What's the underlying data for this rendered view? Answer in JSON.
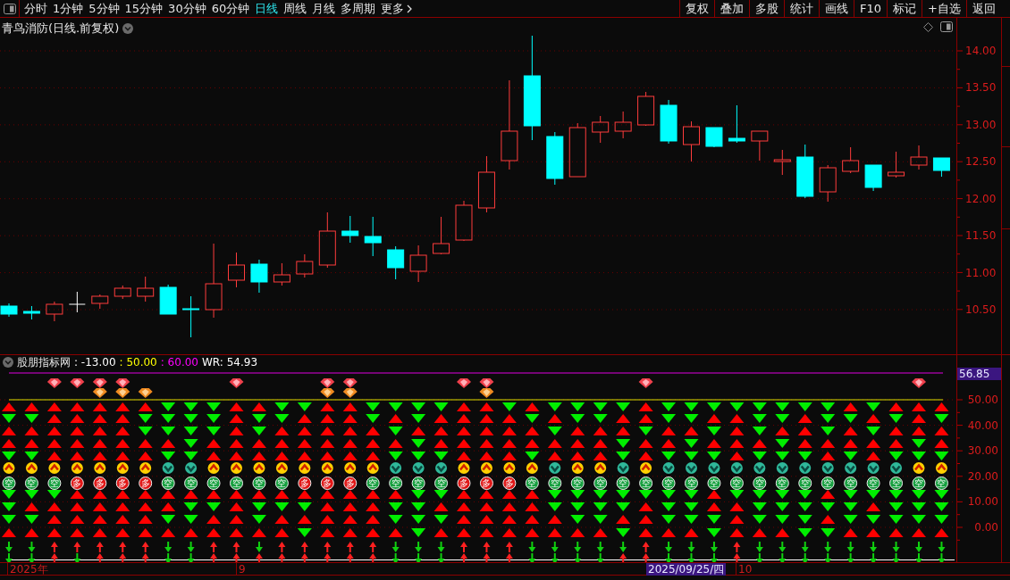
{
  "toolbar": {
    "periods": [
      {
        "label": "分时",
        "selected": false
      },
      {
        "label": "1分钟",
        "selected": false
      },
      {
        "label": "5分钟",
        "selected": false
      },
      {
        "label": "15分钟",
        "selected": false
      },
      {
        "label": "30分钟",
        "selected": false
      },
      {
        "label": "60分钟",
        "selected": false
      },
      {
        "label": "日线",
        "selected": true
      },
      {
        "label": "周线",
        "selected": false
      },
      {
        "label": "月线",
        "selected": false
      },
      {
        "label": "多周期",
        "selected": false
      },
      {
        "label": "更多",
        "selected": false
      }
    ],
    "actions": [
      "复权",
      "叠加",
      "多股",
      "统计",
      "画线",
      "F10",
      "标记",
      "+自选",
      "返回"
    ]
  },
  "price_pane": {
    "title": "青鸟消防(日线.前复权)",
    "axis_labels": [
      "14.00",
      "13.50",
      "13.00",
      "12.50",
      "12.00",
      "11.50",
      "11.00",
      "10.50"
    ]
  },
  "indicator": {
    "name": "股朋指标网",
    "values": [
      {
        "text": ": -13.00",
        "color": "#ffffff"
      },
      {
        "text": ": 50.00",
        "color": "#ffff00"
      },
      {
        "text": ": 60.00",
        "color": "#ff00ff"
      },
      {
        "text": "WR: 54.93",
        "color": "#ffffff"
      }
    ],
    "current_value": "56.85",
    "axis_labels": [
      "50.00",
      "40.00",
      "30.00",
      "20.00",
      "10.00",
      "0.00"
    ],
    "badges": [
      {
        "text": "空",
        "color": "#18a040"
      },
      {
        "text": "空",
        "color": "#18a040"
      },
      {
        "text": "空",
        "color": "#18a040"
      },
      {
        "text": "多",
        "color": "#e01818"
      },
      {
        "text": "多",
        "color": "#e01818"
      },
      {
        "text": "多",
        "color": "#e01818"
      },
      {
        "text": "多",
        "color": "#e01818"
      },
      {
        "text": "空",
        "color": "#18a040"
      },
      {
        "text": "空",
        "color": "#18a040"
      },
      {
        "text": "空",
        "color": "#18a040"
      },
      {
        "text": "空",
        "color": "#18a040"
      },
      {
        "text": "空",
        "color": "#18a040"
      },
      {
        "text": "空",
        "color": "#18a040"
      },
      {
        "text": "多",
        "color": "#e01818"
      },
      {
        "text": "多",
        "color": "#e01818"
      },
      {
        "text": "多",
        "color": "#e01818"
      },
      {
        "text": "空",
        "color": "#18a040"
      },
      {
        "text": "空",
        "color": "#18a040"
      },
      {
        "text": "空",
        "color": "#18a040"
      },
      {
        "text": "空",
        "color": "#18a040"
      },
      {
        "text": "多",
        "color": "#e01818"
      },
      {
        "text": "多",
        "color": "#e01818"
      },
      {
        "text": "多",
        "color": "#e01818"
      },
      {
        "text": "空",
        "color": "#18a040"
      },
      {
        "text": "空",
        "color": "#18a040"
      },
      {
        "text": "空",
        "color": "#18a040"
      },
      {
        "text": "空",
        "color": "#18a040"
      },
      {
        "text": "空",
        "color": "#18a040"
      },
      {
        "text": "空",
        "color": "#18a040"
      },
      {
        "text": "空",
        "color": "#18a040"
      },
      {
        "text": "空",
        "color": "#18a040"
      },
      {
        "text": "空",
        "color": "#18a040"
      },
      {
        "text": "空",
        "color": "#18a040"
      },
      {
        "text": "空",
        "color": "#18a040"
      },
      {
        "text": "空",
        "color": "#18a040"
      },
      {
        "text": "空",
        "color": "#18a040"
      },
      {
        "text": "空",
        "color": "#18a040"
      },
      {
        "text": "空",
        "color": "#18a040"
      },
      {
        "text": "空",
        "color": "#18a040"
      },
      {
        "text": "空",
        "color": "#18a040"
      },
      {
        "text": "空",
        "color": "#18a040"
      },
      {
        "text": "空",
        "color": "#18a040"
      }
    ]
  },
  "date_axis": [
    {
      "text": "2025年",
      "selected": false
    },
    {
      "text": "9",
      "selected": false
    },
    {
      "text": "2025/09/25/四",
      "selected": true
    },
    {
      "text": "10",
      "selected": false
    }
  ]
}
